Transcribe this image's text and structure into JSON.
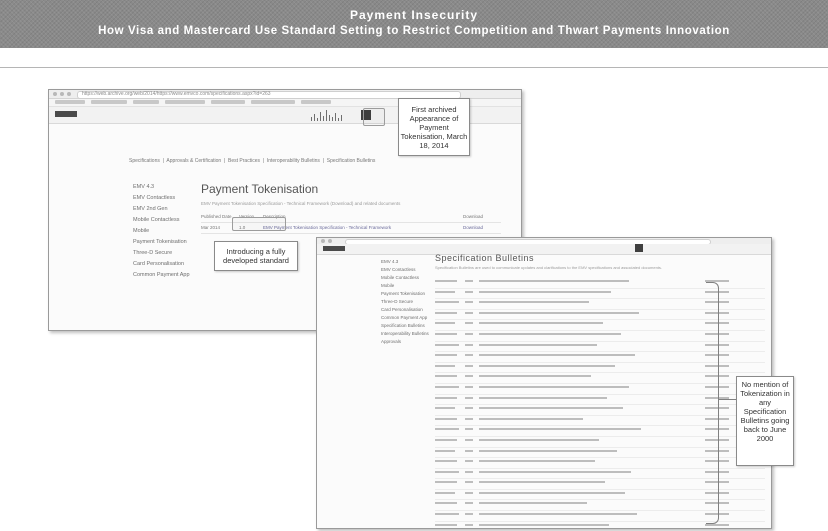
{
  "banner": {
    "title": "Payment Insecurity",
    "subtitle": "How Visa and Mastercard Use Standard Setting to Restrict Competition and Thwart Payments Innovation"
  },
  "screenshot1": {
    "url": "https://web.archive.org/web/2014/https://www.emvco.com/specifications.aspx?id=263",
    "page_title": "Payment Tokenisation",
    "description": "EMV Payment Tokenisation Specification - Technical Framework (Download) and related documents",
    "table_headers": [
      "Published Date",
      "Version",
      "Description",
      "Download"
    ],
    "table_row": [
      "Mar 2014",
      "1.0",
      "EMV Payment Tokenisation Specification - Technical Framework",
      "Download"
    ]
  },
  "screenshot2": {
    "page_title": "Specification Bulletins",
    "description": "Specification Bulletins are used to communicate updates and clarifications to the EMV specifications and associated documents."
  },
  "callouts": {
    "first_archived": "First archived Appearance of Payment Tokenisation, March 18, 2014",
    "introducing": "Introducing a fully developed standard",
    "no_mention": "No mention of Tokenization in any Specification Bulletins going back to June 2000"
  }
}
